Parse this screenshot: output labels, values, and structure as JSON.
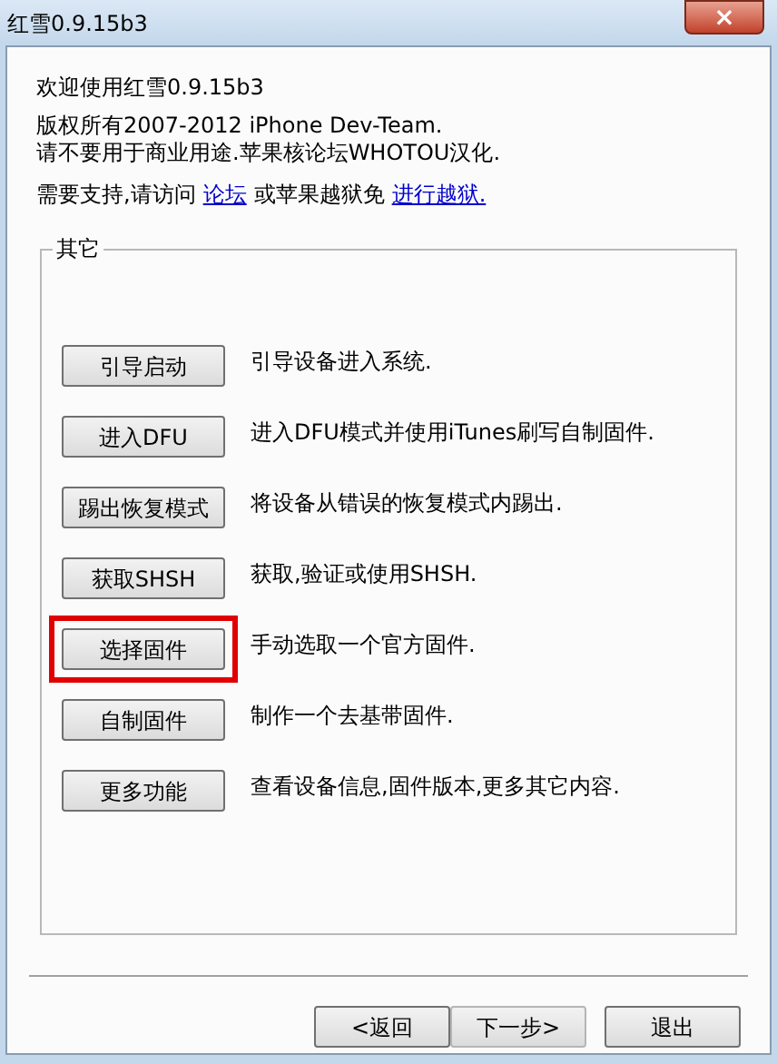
{
  "window": {
    "title": "红雪0.9.15b3",
    "close": "×"
  },
  "welcome": "欢迎使用红雪0.9.15b3",
  "copyright": [
    "版权所有2007-2012 iPhone Dev-Team.",
    "请不要用于商业用途.苹果核论坛WHOTOU汉化."
  ],
  "support": {
    "text": "需要支持,请访问",
    "link1": "论坛",
    "middle": "或苹果越狱免",
    "link2": "进行越狱."
  },
  "group": {
    "title": "其它",
    "items": [
      {
        "button": "引导启动",
        "description": "引导设备进入系统.",
        "highlighted": false
      },
      {
        "button": "进入DFU",
        "description": "进入DFU模式并使用iTunes刷写自制固件.",
        "highlighted": false
      },
      {
        "button": "踢出恢复模式",
        "description": "将设备从错误的恢复模式内踢出.",
        "highlighted": false
      },
      {
        "button": "获取SHSH",
        "description": "获取,验证或使用SHSH.",
        "highlighted": false
      },
      {
        "button": "选择固件",
        "description": "手动选取一个官方固件.",
        "highlighted": true
      },
      {
        "button": "自制固件",
        "description": "制作一个去基带固件.",
        "highlighted": false
      },
      {
        "button": "更多功能",
        "description": "查看设备信息,固件版本,更多其它内容.",
        "highlighted": false
      }
    ]
  },
  "footer_buttons": [
    {
      "label": "<返回",
      "disabled": false
    },
    {
      "label": "下一步>",
      "disabled": true
    },
    {
      "label": "退出",
      "disabled": false
    }
  ]
}
